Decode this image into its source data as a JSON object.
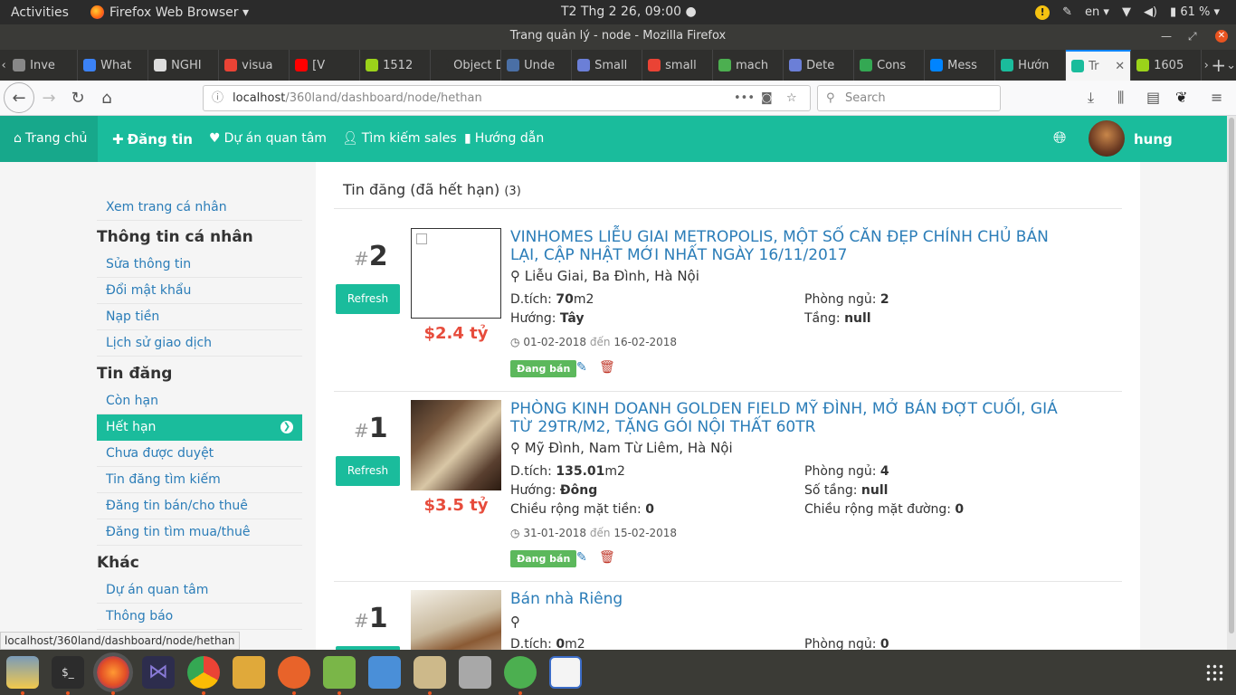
{
  "system": {
    "activities": "Activities",
    "app_name": "Firefox Web Browser ▾",
    "clock": "T2 Thg 2 26, 09:00 ●",
    "lang": "en ▾",
    "battery": "61 % ▾"
  },
  "window": {
    "title": "Trang quản lý - node - Mozilla Firefox"
  },
  "tabs": [
    {
      "label": "Inve",
      "color": "#888888"
    },
    {
      "label": "What",
      "color": "#3b82f6"
    },
    {
      "label": "NGHI",
      "color": "#dddddd"
    },
    {
      "label": "visua",
      "color": "#ea4335"
    },
    {
      "label": "[V",
      "color": "#ff0000"
    },
    {
      "label": "1512",
      "color": "#9bd31a"
    },
    {
      "label": "Object D",
      "color": "#2f2f2d"
    },
    {
      "label": "Unde",
      "color": "#4a6fa5"
    },
    {
      "label": "Small",
      "color": "#6b7fd7"
    },
    {
      "label": "small",
      "color": "#ea4335"
    },
    {
      "label": "mach",
      "color": "#4caf50"
    },
    {
      "label": "Dete",
      "color": "#6b7fd7"
    },
    {
      "label": "Cons",
      "color": "#34a853"
    },
    {
      "label": "Mess",
      "color": "#0084ff"
    },
    {
      "label": "Hướn",
      "color": "#1abc9c"
    },
    {
      "label": "Tr",
      "color": "#1abc9c"
    },
    {
      "label": "1605",
      "color": "#9bd31a"
    }
  ],
  "navbar": {
    "url_host": "localhost",
    "url_path": "/360land/dashboard/node/hethan",
    "search_placeholder": "Search"
  },
  "site_nav": {
    "home": "Trang chủ",
    "post": "Đăng tin",
    "projects": "Dự án quan tâm",
    "sales": "Tìm kiếm sales",
    "guide": "Hướng dẫn",
    "user": "hung"
  },
  "sidebar": {
    "view_profile": "Xem trang cá nhân",
    "personal_heading": "Thông tin cá nhân",
    "edit_info": "Sửa thông tin",
    "change_password": "Đổi mật khẩu",
    "top_up": "Nạp tiền",
    "history": "Lịch sử giao dịch",
    "posts_heading": "Tin đăng",
    "active": "Còn hạn",
    "expired": "Hết hạn",
    "pending": "Chưa được duyệt",
    "search_posts": "Tin đăng tìm kiếm",
    "sell_posts": "Đăng tin bán/cho thuê",
    "buy_posts": "Đăng tin tìm mua/thuê",
    "other_heading": "Khác",
    "fav_projects": "Dự án quan tâm",
    "notifications": "Thông báo"
  },
  "main": {
    "heading": "Tin đăng (đã hết hạn)",
    "count": "(3)",
    "listings": [
      {
        "hash": "#",
        "rank": "2",
        "refresh": "Refresh",
        "price": "$2.4 tỷ",
        "title": "VINHOMES LIỄU GIAI METROPOLIS, MỘT SỐ CĂN ĐẸP CHÍNH CHỦ BÁN LẠI, CẬP NHẬT MỚI NHẤT NGÀY 16/11/2017",
        "location": "Liễu Giai, Ba Đình, Hà Nội",
        "area_label": "D.tích:",
        "area_value": "70",
        "area_unit": "m2",
        "bed_label": "Phòng ngủ:",
        "bed_value": "2",
        "dir_label": "Hướng:",
        "dir_value": "Tây",
        "floor_label": "Tầng:",
        "floor_value": "null",
        "date_from": "01-02-2018",
        "date_sep": "đến",
        "date_to": "16-02-2018",
        "status": "Đang bán"
      },
      {
        "hash": "#",
        "rank": "1",
        "refresh": "Refresh",
        "price": "$3.5 tỷ",
        "title": "PHÒNG KINH DOANH GOLDEN FIELD MỸ ĐÌNH, MỞ BÁN ĐỢT CUỐI, GIÁ TỪ 29TR/M2, TẶNG GÓI NỘI THẤT 60TR",
        "location": "Mỹ Đình, Nam Từ Liêm, Hà Nội",
        "area_label": "D.tích:",
        "area_value": "135.01",
        "area_unit": "m2",
        "bed_label": "Phòng ngủ:",
        "bed_value": "4",
        "dir_label": "Hướng:",
        "dir_value": "Đông",
        "floor_label": "Số tầng:",
        "floor_value": "null",
        "front_label": "Chiều rộng mặt tiền:",
        "front_value": "0",
        "road_label": "Chiều rộng mặt đường:",
        "road_value": "0",
        "date_from": "31-01-2018",
        "date_sep": "đến",
        "date_to": "15-02-2018",
        "status": "Đang bán"
      },
      {
        "hash": "#",
        "rank": "1",
        "title": "Bán nhà Riêng",
        "location": "",
        "area_label": "D.tích:",
        "area_value": "0",
        "area_unit": "m2",
        "bed_label": "Phòng ngủ:",
        "bed_value": "0"
      }
    ]
  },
  "status_url": "localhost/360land/dashboard/node/hethan",
  "colors": {
    "accent": "#1abc9c",
    "price": "#e74c3c",
    "link": "#2b7db8",
    "badge": "#5cb85c"
  }
}
